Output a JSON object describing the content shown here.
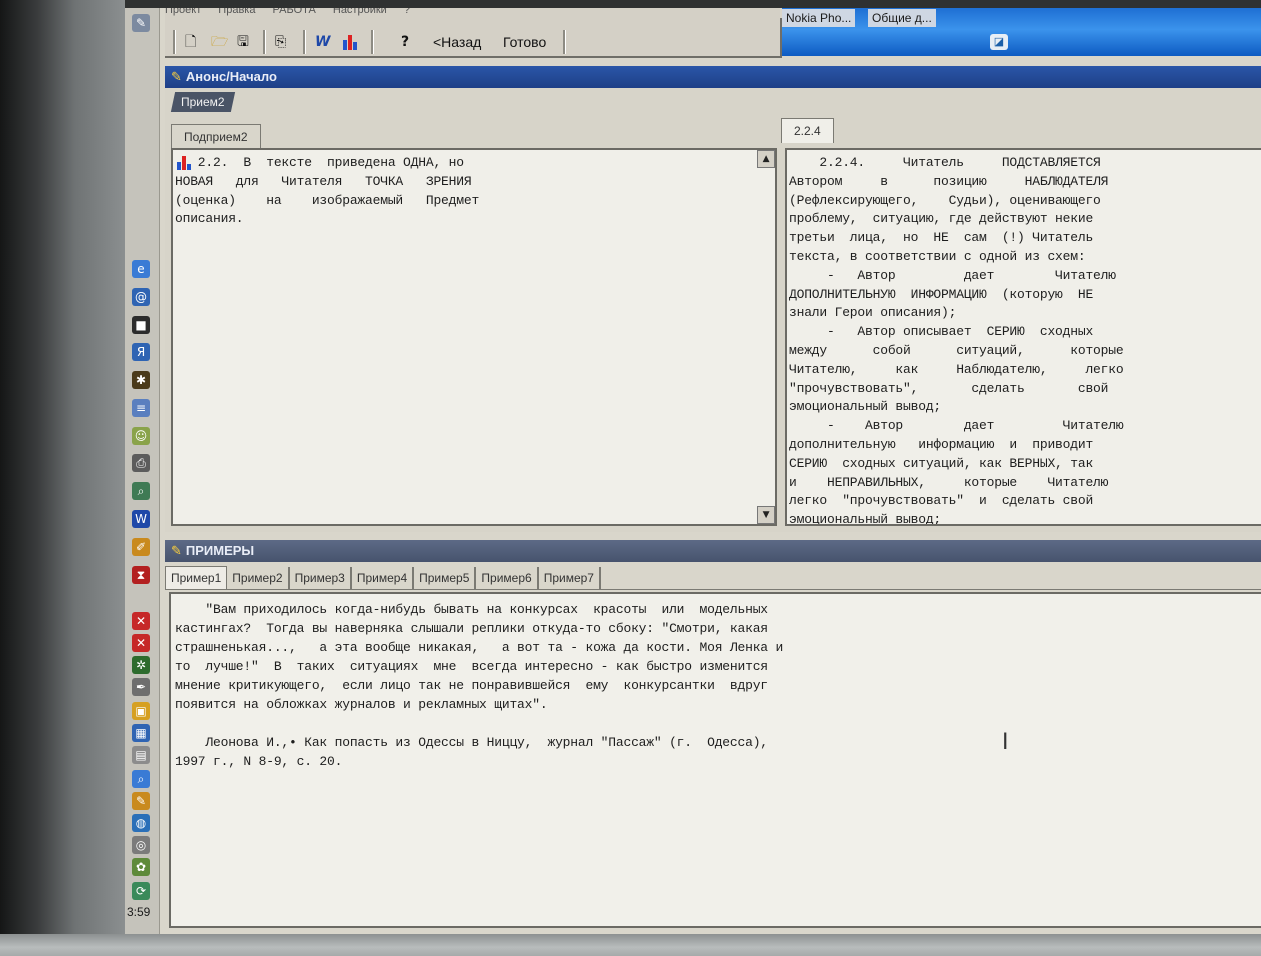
{
  "menubar": {
    "items": [
      "Проект",
      "Правка",
      "РАБОТА",
      "Настройки",
      "?"
    ]
  },
  "toolbar": {
    "help_label": "?",
    "back_label": "<Назад",
    "done_label": "Готово"
  },
  "taskbar": {
    "items": [
      "Nokia Pho...",
      "Общие д..."
    ]
  },
  "window": {
    "title": "Анонс/Начало"
  },
  "priem_tab": "Прием2",
  "left_panel": {
    "tab": "Подприем2",
    "text": "   2.2.  В  тексте  приведена ОДНА, но\nНОВАЯ   для   Читателя   ТОЧКА   ЗРЕНИЯ\n(оценка)    на    изображаемый   Предмет\nописания."
  },
  "right_panel": {
    "tab": "2.2.4",
    "text": "    2.2.4.     Читатель     ПОДСТАВЛЯЕТСЯ\nАвтором     в      позицию     НАБЛЮДАТЕЛЯ\n(Рефлексирующего,    Судьи), оценивающего\nпроблему,  ситуацию, где действуют некие\nтретьи  лица,  но  НЕ  сам  (!) Читатель\nтекста, в соответствии с одной из схем:\n     -   Автор         дает        Читателю\nДОПОЛНИТЕЛЬНУЮ  ИНФОРМАЦИЮ  (которую  НЕ\nзнали Герои описания);\n     -   Автор описывает  СЕРИЮ  сходных\nмежду      собой      ситуаций,      которые\nЧитателю,     как     Наблюдателю,     легко\n\"прочувствовать\",       сделать       свой\nэмоциональный вывод;\n     -    Автор        дает         Читателю\nдополнительную   информацию  и  приводит\nСЕРИЮ  сходных ситуаций, как ВЕРНЫХ, так\nи    НЕПРАВИЛЬНЫХ,     которые    Читателю\nлегко  \"прочувствовать\"  и  сделать свой\nэмоциональный вывод;"
  },
  "examples": {
    "title": "ПРИМЕРЫ",
    "tabs": [
      "Пример1",
      "Пример2",
      "Пример3",
      "Пример4",
      "Пример5",
      "Пример6",
      "Пример7"
    ],
    "active_tab": "Пример1",
    "text": "    \"Вам приходилось когда-нибудь бывать на конкурсах  красоты  или  модельных\nкастингах?  Тогда вы наверняка слышали реплики откуда-то сбоку: \"Смотри, какая\nстрашненькая...,   а эта вообще никакая,   а вот та - кожа да кости. Моя Ленка и\nто  лучше!\"  В  таких  ситуациях  мне  всегда интересно - как быстро изменится\nмнение критикующего,  если лицо так не понравившейся  ему  конкурсантки  вдруг\nпоявится на обложках журналов и рекламных щитах\".\n\n    Леонова И.,• Как попасть из Одессы в Ниццу,  журнал \"Пассаж\" (г.  Одесса),\n1997 г., N 8-9, с. 20."
  },
  "clock": "3:59",
  "colors": {
    "titlebar": "#1e3f87",
    "taskbar": "#2a80e0",
    "pane_bg": "#f0efe9",
    "window_bg": "#d9d6cb"
  },
  "quicklaunch_icons": [
    "ie-icon",
    "outlook-icon",
    "app-icon",
    "yandex-icon",
    "spider-icon",
    "notes-icon",
    "people-icon",
    "printer-icon",
    "search-icon",
    "word-icon",
    "pencil-icon",
    "hourglass-icon",
    "x-icon",
    "x2-icon",
    "bug-icon",
    "pen-icon",
    "box-icon",
    "grid-icon",
    "doc-icon",
    "magnifier-icon",
    "tag-icon",
    "globe-icon",
    "cd-icon",
    "gear-icon",
    "sync-icon"
  ]
}
